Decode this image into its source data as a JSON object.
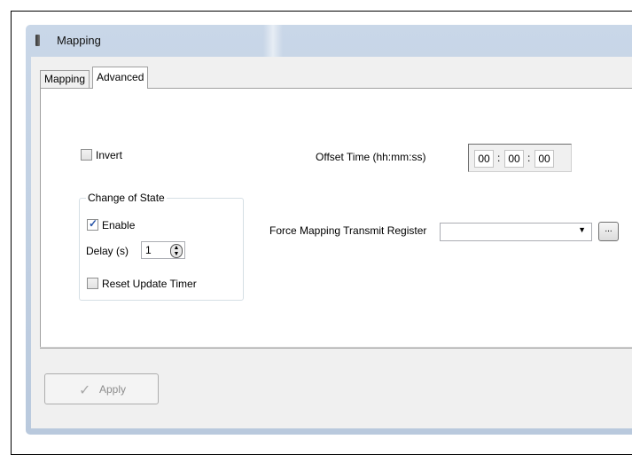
{
  "window": {
    "title": "Mapping"
  },
  "tabs": [
    {
      "label": "Mapping",
      "active": false
    },
    {
      "label": "Advanced",
      "active": true
    }
  ],
  "advanced": {
    "invert": {
      "label": "Invert",
      "checked": false
    },
    "offset_time": {
      "label": "Offset Time (hh:mm:ss)",
      "hours": "00",
      "minutes": "00",
      "seconds": "00",
      "separator": ":"
    },
    "change_of_state": {
      "title": "Change of State",
      "enable": {
        "label": "Enable",
        "checked": true
      },
      "delay": {
        "label": "Delay (s)",
        "value": "1"
      },
      "reset_update_timer": {
        "label": "Reset Update Timer",
        "checked": false
      }
    },
    "force_mapping": {
      "label": "Force Mapping Transmit Register",
      "selected": "",
      "browse_label": "..."
    }
  },
  "footer": {
    "apply_label": "Apply",
    "apply_enabled": false
  },
  "icons": {
    "app": "app-icon",
    "apply": "checkmark-icon"
  },
  "colors": {
    "frame": "#c3d2e5",
    "panel": "#ffffff",
    "checkbox_tick": "#2a56a8"
  }
}
